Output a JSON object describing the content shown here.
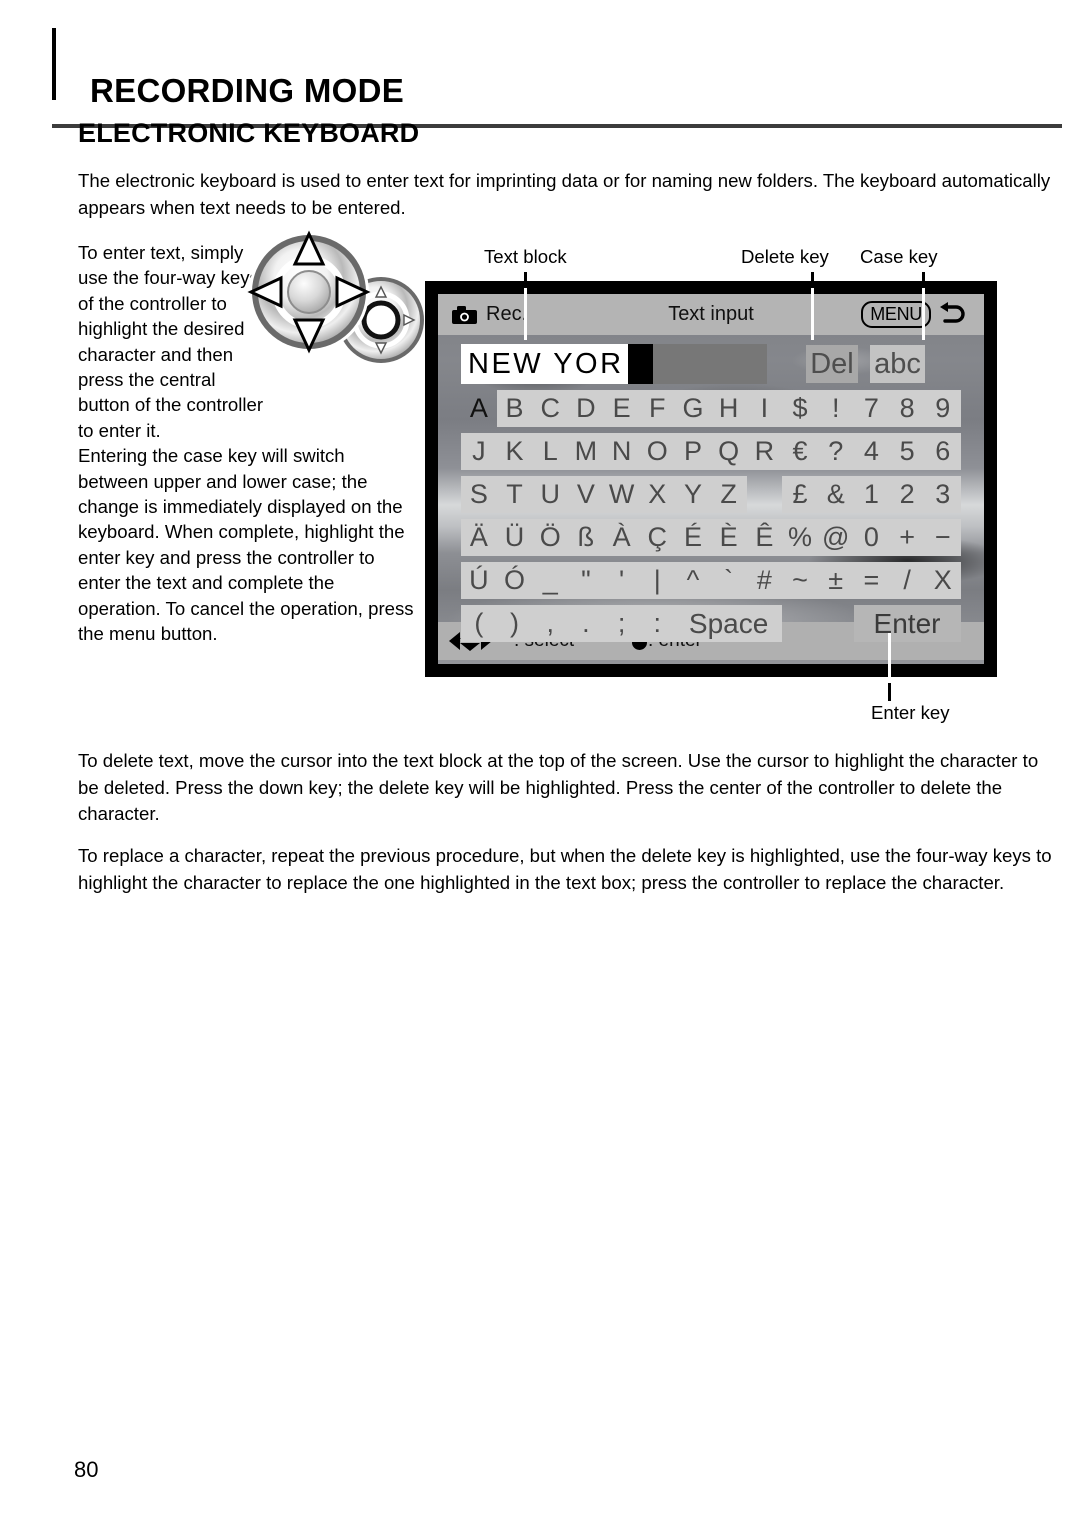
{
  "header": {
    "title": "RECORDING MODE",
    "section_title": "ELECTRONIC KEYBOARD"
  },
  "intro_paragraph": "The electronic keyboard is used to enter text for imprinting data or for naming new folders. The keyboard automatically appears when text needs to be entered.",
  "left_column": {
    "narrow_text": "To enter text, simply use the four-way keys of the controller to highlight the desired character and then press the central button of the controller to enter it.",
    "wide_text": "Entering the case key will switch between upper and lower case; the change is immediately displayed on the keyboard. When complete, highlight the enter key and press the controller to enter the text and complete the operation. To cancel the operation, press the menu button."
  },
  "callouts": {
    "text_block": "Text block",
    "delete_key": "Delete key",
    "case_key": "Case key",
    "enter_key": "Enter key"
  },
  "lcd": {
    "mode_label": "Rec.",
    "title": "Text input",
    "menu_badge": "MENU",
    "text_value": "NEW YOR",
    "delete_key_label": "Del",
    "case_key_label": "abc",
    "space_key_label": "Space",
    "enter_key_label": "Enter",
    "guide_select": ": select",
    "guide_enter": ": enter",
    "keyboard_rows": [
      [
        "A",
        "B",
        "C",
        "D",
        "E",
        "F",
        "G",
        "H",
        "I",
        "$",
        "!",
        "7",
        "8",
        "9"
      ],
      [
        "J",
        "K",
        "L",
        "M",
        "N",
        "O",
        "P",
        "Q",
        "R",
        "€",
        "?",
        "4",
        "5",
        "6"
      ],
      [
        "S",
        "T",
        "U",
        "V",
        "W",
        "X",
        "Y",
        "Z",
        "",
        "£",
        "&",
        "1",
        "2",
        "3"
      ],
      [
        "Ä",
        "Ü",
        "Ö",
        "ß",
        "À",
        "Ç",
        "É",
        "È",
        "Ê",
        "%",
        "@",
        "0",
        "+",
        "−"
      ],
      [
        "Ú",
        "Ó",
        "_",
        "\"",
        "'",
        "|",
        "^",
        "`",
        "#",
        "~",
        "±",
        "=",
        "/",
        "X"
      ],
      [
        "(",
        ")",
        ",",
        ".",
        ";",
        ":"
      ]
    ],
    "selected_key": "A"
  },
  "delete_paragraph": "To delete text, move the cursor into the text block at the top of the screen. Use the cursor to highlight the character to be deleted. Press the down key; the delete key will be highlighted. Press the center of the controller to delete the character.",
  "replace_paragraph": "To replace a character, repeat the previous procedure, but when the delete key is highlighted, use the four-way keys to highlight the character to replace the one highlighted in the text box; press the controller to replace the character.",
  "page_number": "80",
  "colors": {
    "rule": "#3c3c3c",
    "lcd_bezel": "#000000",
    "lcd_bar": "#b4b4b4",
    "key_face": "#cfcfcf",
    "enter_face": "#b6b6b6",
    "text_field": "#777777"
  }
}
